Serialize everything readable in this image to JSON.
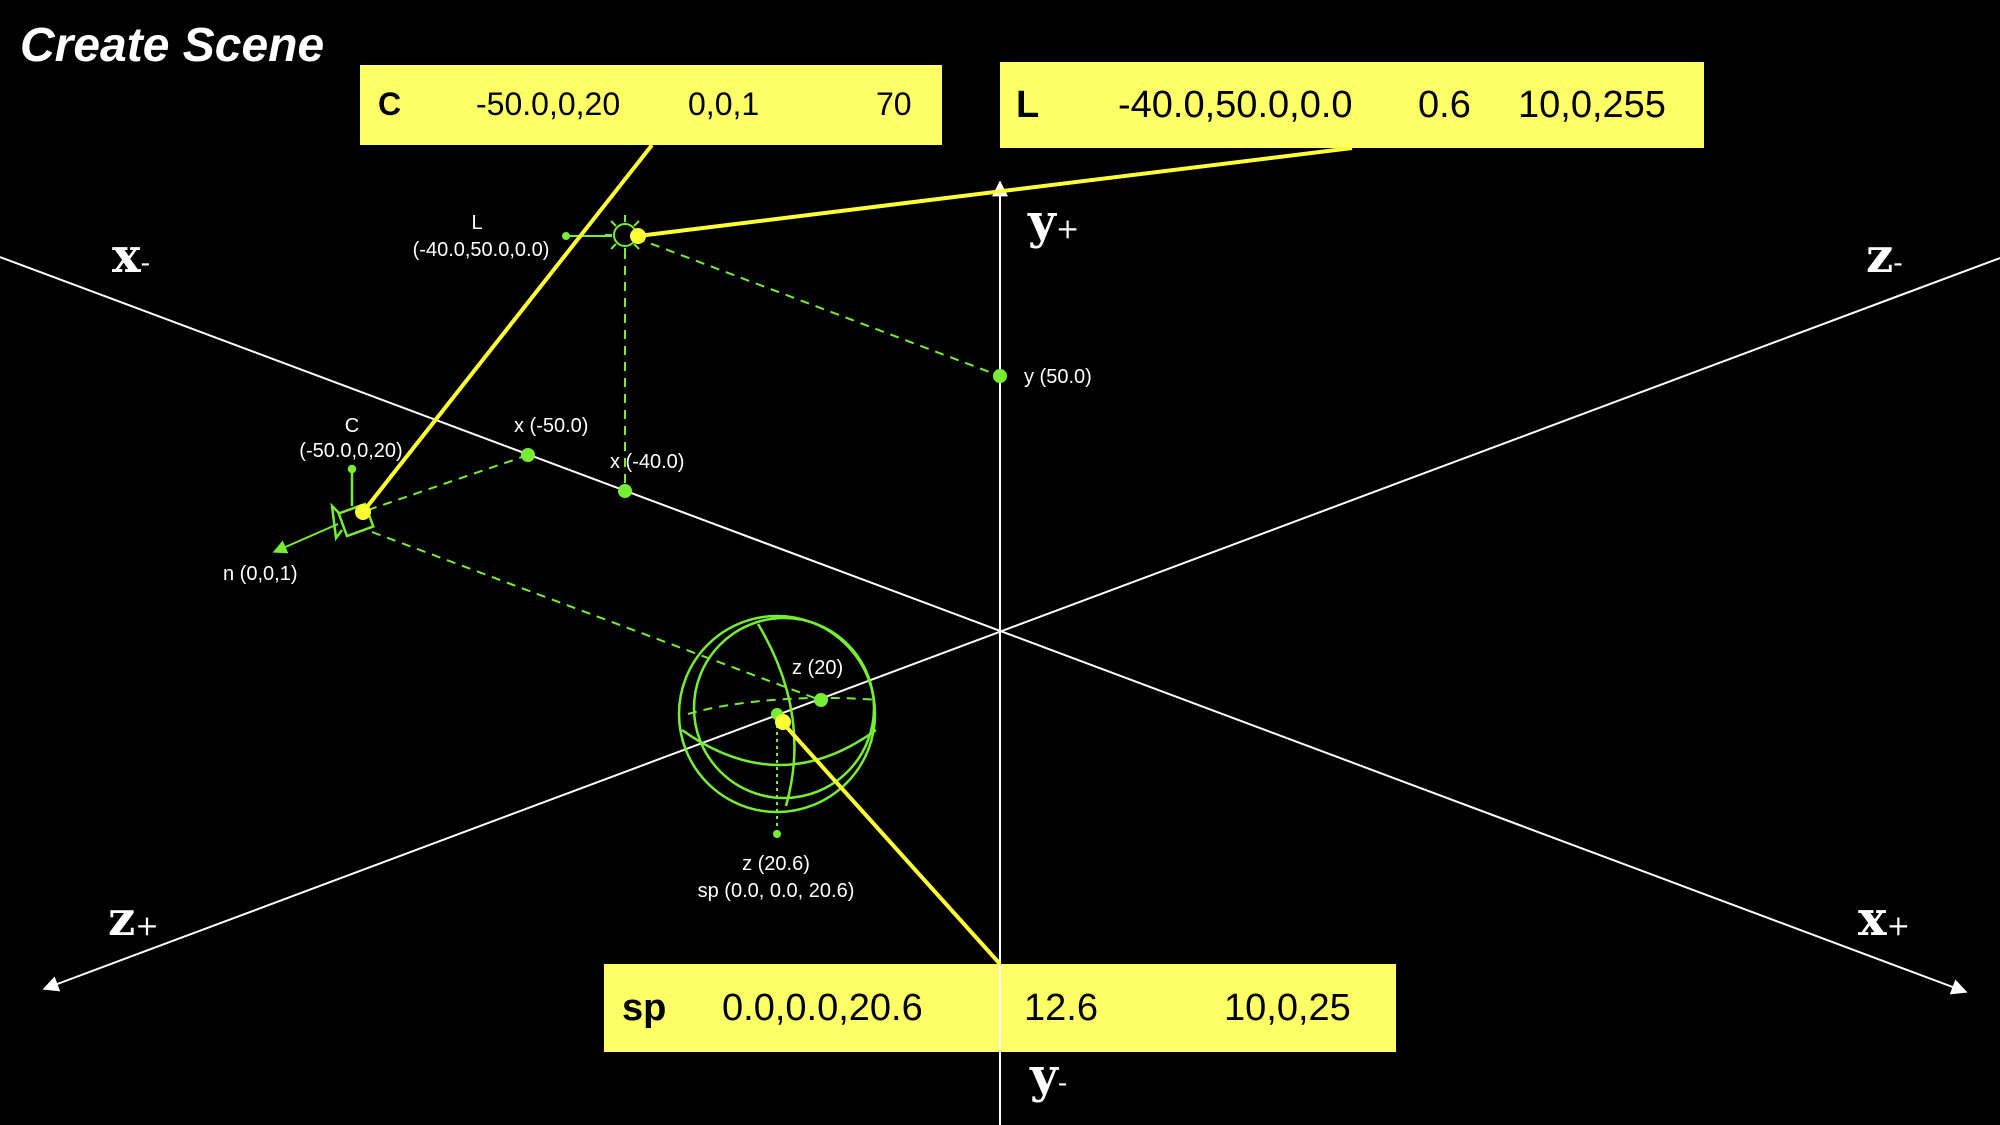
{
  "title": "Create Scene",
  "camera_box": {
    "key": "C",
    "position": "-50.0,0,20",
    "normal": "0,0,1",
    "fov": "70"
  },
  "light_box": {
    "key": "L",
    "position": "-40.0,50.0,0.0",
    "brightness": "0.6",
    "color": "10,0,255"
  },
  "sphere_box": {
    "key": "sp",
    "center": "0.0,0.0,20.6",
    "diameter": "12.6",
    "color": "10,0,25"
  },
  "axes": {
    "x_minus": "x",
    "x_minus_sign": "-",
    "x_plus": "x",
    "x_plus_sign": "+",
    "y_plus": "y",
    "y_plus_sign": "+",
    "y_minus": "y",
    "y_minus_sign": "-",
    "z_minus": "z",
    "z_minus_sign": "-",
    "z_plus": "z",
    "z_plus_sign": "+"
  },
  "labels": {
    "light_name": "L",
    "light_coords": "(-40.0,50.0,0.0)",
    "camera_name": "C",
    "camera_coords": "(-50.0,0,20)",
    "camera_normal": "n (0,0,1)",
    "x_cam": "x (-50.0)",
    "x_light": "x (-40.0)",
    "y_light": "y (50.0)",
    "z_sphere_axis": "z (20)",
    "z_sphere": "z (20.6)",
    "sp_coords": "sp (0.0, 0.0, 20.6)"
  },
  "colors": {
    "background": "#000000",
    "highlight": "#ffff66",
    "leader": "#ffff33",
    "guide": "#77ee33",
    "axis": "#ffffff"
  },
  "icons": [
    "camera-icon",
    "sun-icon",
    "sphere-icon"
  ]
}
